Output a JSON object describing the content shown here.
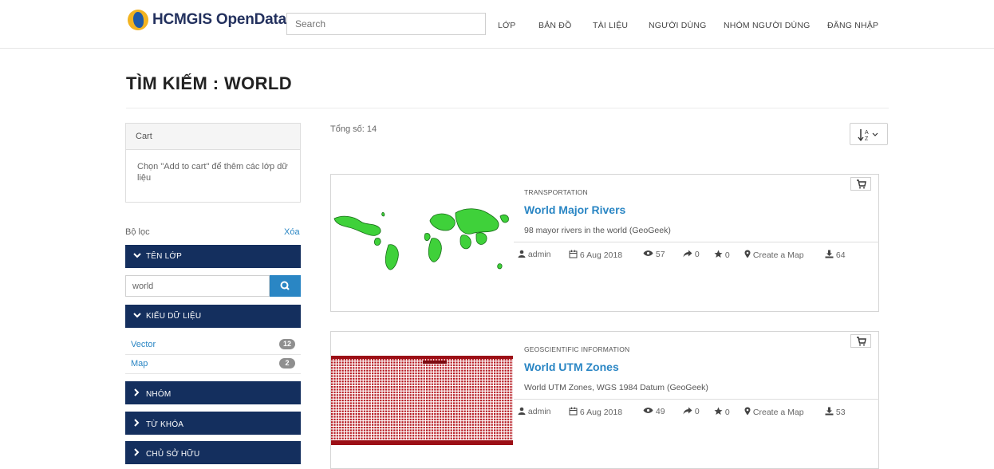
{
  "brand": {
    "name": "HCMGIS OpenData"
  },
  "search": {
    "placeholder": "Search"
  },
  "nav": [
    {
      "label": "LỚP"
    },
    {
      "label": "BẢN ĐỒ"
    },
    {
      "label": "TÀI LIỆU"
    },
    {
      "label": "NGƯỜI DÙNG"
    },
    {
      "label": "NHÓM NGƯỜI DÙNG"
    },
    {
      "label": "ĐĂNG NHẬP"
    }
  ],
  "page": {
    "title": "TÌM KIẾM : WORLD"
  },
  "cart": {
    "title": "Cart",
    "body": "Chọn \"Add to cart\" để thêm các lớp dữ liệu"
  },
  "filters": {
    "label": "Bộ lọc",
    "clear": "Xóa",
    "sections": {
      "name": "TÊN LỚP",
      "type": "KIỂU DỮ LIỆU",
      "group": "NHÓM",
      "keyword": "TỪ KHÓA",
      "owner": "CHỦ SỞ HỮU"
    },
    "name_value": "world",
    "types": [
      {
        "label": "Vector",
        "count": "12"
      },
      {
        "label": "Map",
        "count": "2"
      }
    ]
  },
  "results": {
    "total": "Tổng số: 14",
    "items": [
      {
        "category": "TRANSPORTATION",
        "title": "World Major Rivers",
        "description": "98 mayor rivers in the world (GeoGeek)",
        "owner": "admin",
        "date": "6 Aug 2018",
        "views": "57",
        "shares": "0",
        "rating": "0",
        "action": "Create a Map",
        "downloads": "64",
        "thumb_color": "#3fd13a"
      },
      {
        "category": "GEOSCIENTIFIC INFORMATION",
        "title": "World UTM Zones",
        "description": "World UTM Zones, WGS 1984 Datum (GeoGeek)",
        "owner": "admin",
        "date": "6 Aug 2018",
        "views": "49",
        "shares": "0",
        "rating": "0",
        "action": "Create a Map",
        "downloads": "53",
        "thumb_color": "#b3121a"
      }
    ]
  },
  "colors": {
    "navy": "#142f5e",
    "link": "#2a86c4"
  },
  "icons": {
    "user": "user-icon",
    "calendar": "calendar-icon",
    "eye": "eye-icon",
    "share": "share-icon",
    "star": "star-icon",
    "pin": "map-marker-icon",
    "download": "download-icon",
    "cart": "cart-icon",
    "sort": "sort-alpha-icon",
    "search": "search-icon",
    "chevron": "chevron-icon"
  }
}
